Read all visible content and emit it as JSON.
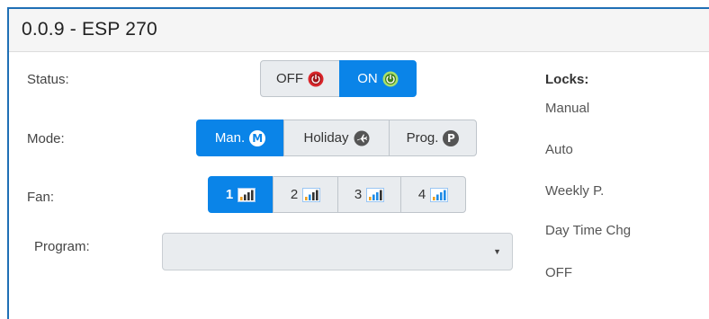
{
  "panel": {
    "title": "0.0.9 - ESP 270"
  },
  "status": {
    "label": "Status:",
    "options": [
      {
        "label": "OFF",
        "icon": "power-off-icon",
        "active": false
      },
      {
        "label": "ON",
        "icon": "power-on-icon",
        "active": true
      }
    ]
  },
  "mode": {
    "label": "Mode:",
    "options": [
      {
        "label": "Man.",
        "icon_letter": "M",
        "active": true
      },
      {
        "label": "Holiday",
        "icon": "plane-icon",
        "active": false
      },
      {
        "label": "Prog.",
        "icon_letter": "P",
        "active": false
      }
    ]
  },
  "fan": {
    "label": "Fan:",
    "options": [
      {
        "label": "1",
        "level": 1,
        "active": true
      },
      {
        "label": "2",
        "level": 2,
        "active": false
      },
      {
        "label": "3",
        "level": 3,
        "active": false
      },
      {
        "label": "4",
        "level": 4,
        "active": false
      }
    ]
  },
  "program": {
    "label": "Program:",
    "value": ""
  },
  "locks": {
    "title": "Locks:",
    "items": [
      "Manual",
      "Auto",
      "Weekly P.",
      "Day Time Chg",
      "OFF"
    ]
  },
  "colors": {
    "accent": "#0a84e8",
    "power_off": "#d9262b",
    "power_on": "#7ec94b",
    "border": "#1f6fb5"
  }
}
